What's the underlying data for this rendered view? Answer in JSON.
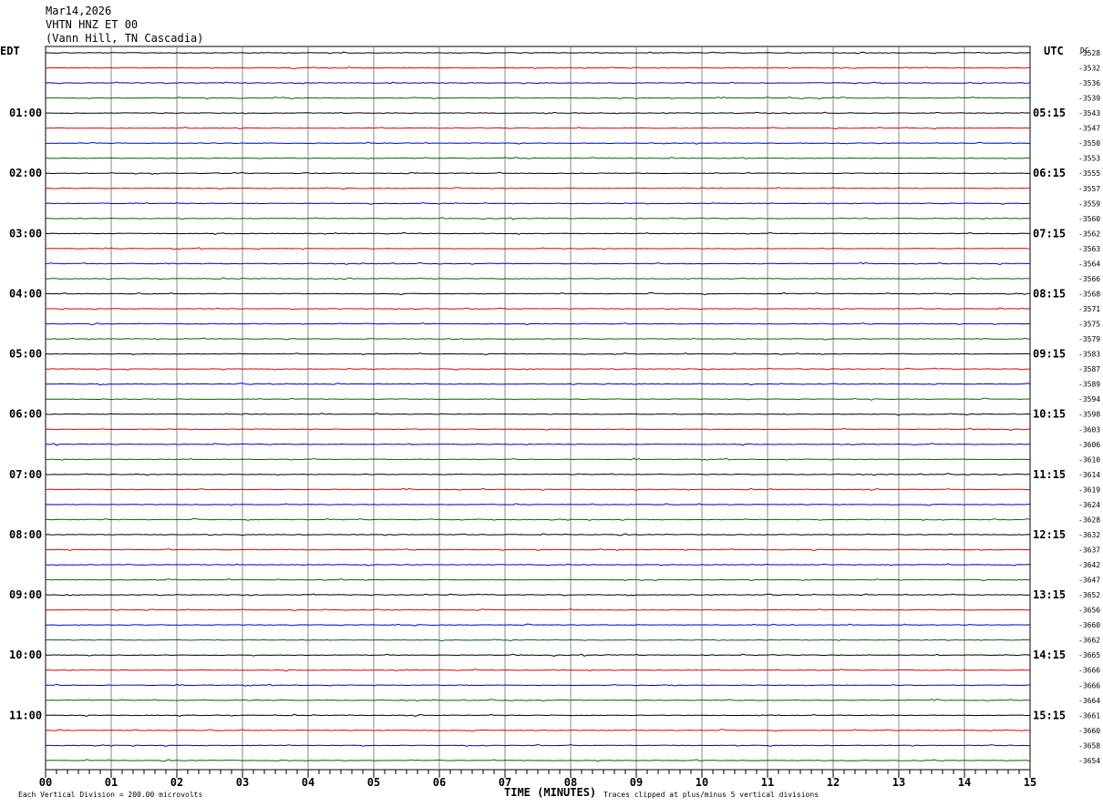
{
  "header": {
    "date": "Mar14,2026",
    "station": "VHTN HNZ ET 00",
    "location": "(Vann Hill, TN Cascadia)"
  },
  "left_zone": "EDT",
  "right_zone": "UTC",
  "dc_header": "DC",
  "footer": {
    "scale_note": "Each Vertical Division =  200.00 microvolts",
    "clip_note": "Traces clipped at plus/minus 5 vertical divisions"
  },
  "chart_data": {
    "type": "line",
    "title": "",
    "xlabel": "TIME (MINUTES)",
    "ylabel": "",
    "xlim": [
      0,
      15
    ],
    "x_ticks": [
      "00",
      "01",
      "02",
      "03",
      "04",
      "05",
      "06",
      "07",
      "08",
      "09",
      "10",
      "11",
      "12",
      "13",
      "14",
      "15"
    ],
    "trace_colors": [
      "#000000",
      "#dd0000",
      "#0000cc",
      "#006600"
    ],
    "edt_hour_labels": [
      "01:00",
      "02:00",
      "03:00",
      "04:00",
      "05:00",
      "06:00",
      "07:00",
      "08:00",
      "09:00",
      "10:00",
      "11:00"
    ],
    "utc_hour_labels": [
      "05:15",
      "06:15",
      "07:15",
      "08:15",
      "09:15",
      "10:15",
      "11:15",
      "12:15",
      "13:15",
      "14:15",
      "15:15"
    ],
    "dc_offsets": [
      "-3528",
      "-3532",
      "-3536",
      "-3539",
      "-3543",
      "-3547",
      "-3550",
      "-3553",
      "-3555",
      "-3557",
      "-3559",
      "-3560",
      "-3562",
      "-3563",
      "-3564",
      "-3566",
      "-3568",
      "-3571",
      "-3575",
      "-3579",
      "-3583",
      "-3587",
      "-3589",
      "-3594",
      "-3598",
      "-3603",
      "-3606",
      "-3610",
      "-3614",
      "-3619",
      "-3624",
      "-3628",
      "-3632",
      "-3637",
      "-3642",
      "-3647",
      "-3652",
      "-3656",
      "-3660",
      "-3662",
      "-3665",
      "-3666",
      "-3666",
      "-3664",
      "-3661",
      "-3660",
      "-3658",
      "-3654"
    ],
    "grid": true
  }
}
